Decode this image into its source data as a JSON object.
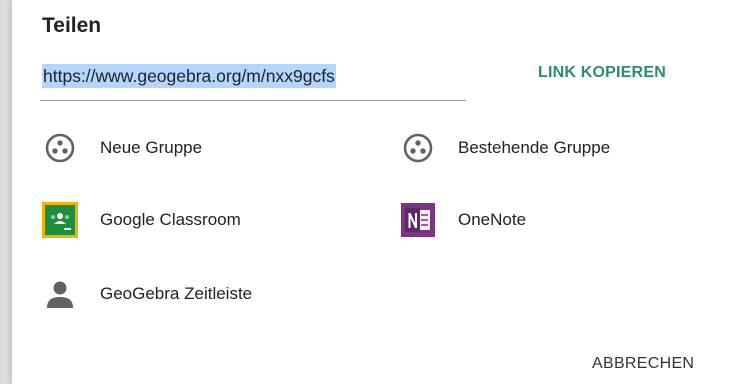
{
  "dialog": {
    "title": "Teilen",
    "link": {
      "url": "https://www.geogebra.org/m/nxx9gcfs",
      "copy_label": "LINK KOPIEREN"
    },
    "options": [
      {
        "label": "Neue Gruppe",
        "icon": "group-icon"
      },
      {
        "label": "Bestehende Gruppe",
        "icon": "group-icon"
      },
      {
        "label": "Google Classroom",
        "icon": "google-classroom-icon"
      },
      {
        "label": "OneNote",
        "icon": "onenote-icon"
      },
      {
        "label": "GeoGebra Zeitleiste",
        "icon": "person-icon"
      }
    ],
    "cancel_label": "ABBRECHEN"
  },
  "colors": {
    "accent": "#2e8b6e",
    "selection": "#b4d5fe",
    "onenote": "#7b3583",
    "classroom_green": "#1e8e3e",
    "classroom_yellow": "#f4b400",
    "icon_gray": "#5f6368"
  }
}
